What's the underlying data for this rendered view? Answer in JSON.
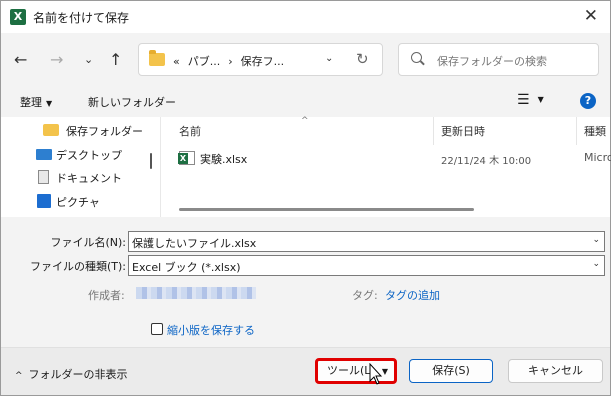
{
  "title_bar": {
    "app_icon": "excel-icon",
    "title": "名前を付けて保存",
    "close": "✕"
  },
  "nav": {
    "back": "←",
    "forward": "→",
    "recent": "⌄",
    "up": "↑",
    "breadcrumbs": [
      "«",
      "パブ...",
      "›",
      "保存フ..."
    ],
    "address_dropdown": "⌄",
    "refresh": "↻",
    "search_placeholder": "保存フォルダーの検索"
  },
  "toolbar": {
    "organize": "整理",
    "organize_caret": "▼",
    "new_folder": "新しいフォルダー",
    "view_icon": "☰",
    "view_caret": "▼",
    "help": "?"
  },
  "sidebar": {
    "items": [
      {
        "label": "保存フォルダー",
        "icon": "folder-icon"
      },
      {
        "label": "デスクトップ",
        "icon": "desktop-icon"
      },
      {
        "label": "ドキュメント",
        "icon": "document-icon"
      },
      {
        "label": "ピクチャ",
        "icon": "pictures-icon"
      }
    ]
  },
  "file_list": {
    "columns": [
      "名前",
      "更新日時",
      "種類"
    ],
    "sort_arrow": "^",
    "rows": [
      {
        "name": "実験.xlsx",
        "modified": "22/11/24 木 10:00",
        "type": "Micro"
      }
    ]
  },
  "form": {
    "filename_label": "ファイル名(N):",
    "filename_value": "保護したいファイル.xlsx",
    "filetype_label": "ファイルの種類(T):",
    "filetype_value": "Excel ブック (*.xlsx)",
    "dropdown_caret": "⌄",
    "author_label": "作成者:",
    "tags_label": "タグ:",
    "tags_link": "タグの追加",
    "thumbnail_label": "縮小版を保存する"
  },
  "footer": {
    "hide_folders": "フォルダーの非表示",
    "hide_caret": "^",
    "tools": "ツール(L)",
    "tools_caret": "▼",
    "save": "保存(S)",
    "cancel": "キャンセル"
  },
  "colors": {
    "accent": "#0b64c5",
    "highlight": "#e00000",
    "excel": "#1d6f42"
  }
}
